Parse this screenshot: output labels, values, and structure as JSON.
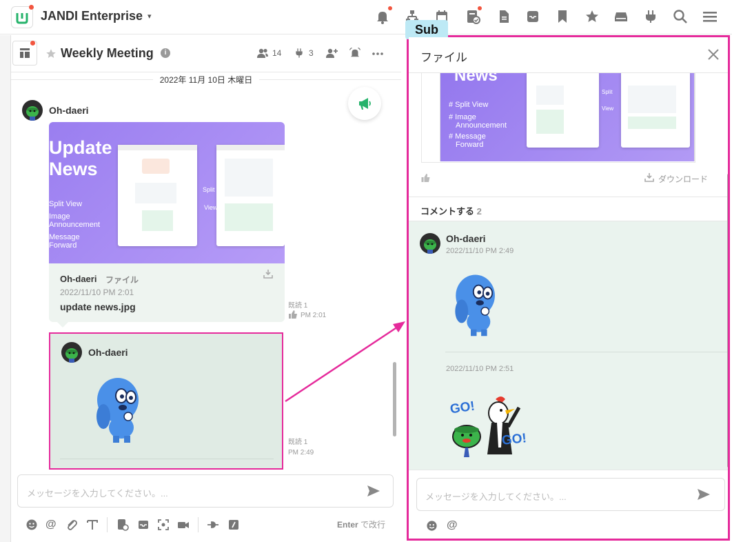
{
  "app": {
    "team_name": "JANDI Enterprise",
    "top_icons": [
      "bell-icon",
      "org-chart-icon",
      "calendar-icon",
      "todo-icon",
      "file-icon",
      "archive-icon",
      "bookmark-icon",
      "star-icon",
      "drive-icon",
      "plug-icon",
      "search-icon",
      "menu-icon"
    ]
  },
  "channel": {
    "title": "Weekly Meeting",
    "member_count": "14",
    "connect_count": "3"
  },
  "date_separator": "2022年 11月 10日 木曜日",
  "messages": [
    {
      "user": "Oh-daeri",
      "file": {
        "preview_title_line1": "Update",
        "preview_title_line2": "News",
        "preview_features": [
          "Split View",
          "Image",
          "Announcement",
          "Message",
          "Forward"
        ],
        "preview_split_label": "Split",
        "preview_view_label": "View",
        "owner": "Oh-daeri",
        "type_label": "ファイル",
        "date": "2022/11/10 PM 2:01",
        "filename": "update news.jpg",
        "read_label": "既読 1",
        "time": "PM 2:01"
      }
    },
    {
      "user": "Oh-daeri",
      "read_label": "既読 1",
      "time": "PM 2:49"
    }
  ],
  "composer": {
    "placeholder": "メッセージを入力してください。...",
    "enter_key": "Enter",
    "enter_hint": " で改行"
  },
  "sub_panel": {
    "tag": "Sub",
    "title": "ファイル",
    "preview_word": "News",
    "preview_features": [
      "# Split View",
      "# Image",
      "Announcement",
      "# Message",
      "Forward"
    ],
    "preview_split": "Split",
    "preview_view": "View",
    "download_label": "ダウンロード",
    "comments_label": "コメントする",
    "comments_count": "2",
    "comments": [
      {
        "user": "Oh-daeri",
        "time": "2022/11/10 PM 2:49"
      },
      {
        "time": "2022/11/10 PM 2:51"
      }
    ],
    "sticker_text": "GO!",
    "composer_placeholder": "メッセージを入力してください。..."
  },
  "colors": {
    "highlight": "#e52a9b",
    "brand_green": "#26b36b",
    "badge_red": "#f2553f",
    "sub_tag_bg": "#bde9f5",
    "thread_bg": "#eaf3ee"
  }
}
